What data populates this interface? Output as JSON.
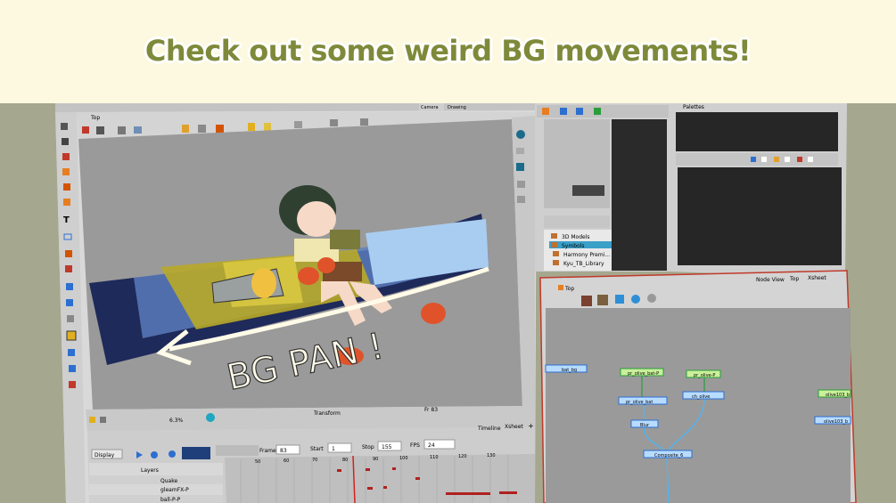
{
  "banner": {
    "title": "Check out some weird BG movements!"
  },
  "colors": {
    "banner_bg": "#fdf9e0",
    "banner_text": "#7e8a3a",
    "outer_bg": "#a5a88e",
    "accent": "#3a6fd8",
    "node_border": "#c0392b"
  },
  "camera_view": {
    "tab_title": "Top",
    "tabs": [
      "Camera",
      "Drawing"
    ],
    "status_zoom": "6.3%",
    "status_mode": "Transform",
    "status_frame": "Fr 83",
    "artwork_text": "BG PAN !"
  },
  "library": {
    "items": [
      "3D Models",
      "Symbols",
      "Harmony Premi...",
      "Kyu_TB_Library"
    ],
    "selected": "Symbols"
  },
  "palettes": {
    "title": "Palettes"
  },
  "node_view": {
    "tabs": [
      "Node View",
      "Top",
      "Xsheet"
    ],
    "breadcrumb": "Top",
    "nodes": [
      "bat_bg",
      "pr_olive_bat-P",
      "pr_olive-P",
      "pr_olive_bat",
      "ch_olive",
      "Blur",
      "Composite_6",
      "olive103_b",
      "olive103_b"
    ]
  },
  "timeline": {
    "tabs": [
      "Timeline",
      "Xsheet"
    ],
    "display_label": "Display",
    "frame_label": "Frame",
    "frame_value": "83",
    "start_label": "Start",
    "start_value": "1",
    "stop_label": "Stop",
    "stop_value": "155",
    "fps_label": "FPS",
    "fps_value": "24",
    "layers_header": "Layers",
    "layers": [
      "Quake",
      "gleamFX-P",
      "ball-P-P"
    ],
    "ruler": [
      "50",
      "60",
      "70",
      "80",
      "90",
      "100",
      "110",
      "120",
      "130"
    ]
  }
}
